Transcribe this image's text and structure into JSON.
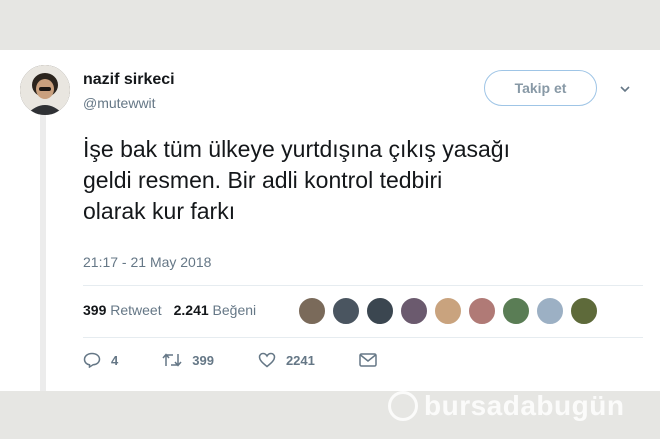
{
  "user": {
    "display_name": "nazif sirkeci",
    "handle": "@mutewwit"
  },
  "follow_button": {
    "label": "Takip et"
  },
  "tweet": {
    "line1": "İşe bak tüm ülkeye yurtdışına çıkış yasağı",
    "line2": "geldi resmen. Bir adli kontrol tedbiri",
    "line3": "olarak kur farkı",
    "timestamp": "21:17 - 21 May 2018"
  },
  "stats": {
    "retweets_count": "399",
    "retweets_label": "Retweet",
    "likes_count": "2.241",
    "likes_label": "Beğeni"
  },
  "likers": [
    {
      "color": "#7a6a5a"
    },
    {
      "color": "#4a5560"
    },
    {
      "color": "#3b4650"
    },
    {
      "color": "#6b5a6e"
    },
    {
      "color": "#c9a37e"
    },
    {
      "color": "#b07a76"
    },
    {
      "color": "#5a7d55"
    },
    {
      "color": "#9cb0c4"
    },
    {
      "color": "#5e6a3a"
    }
  ],
  "actions": {
    "reply_count": "4",
    "retweet_count": "399",
    "like_count": "2241"
  },
  "watermark": {
    "text": "bursadabugün"
  },
  "colors": {
    "accent": "#1da1f2",
    "text": "#14171a",
    "muted": "#657786"
  }
}
